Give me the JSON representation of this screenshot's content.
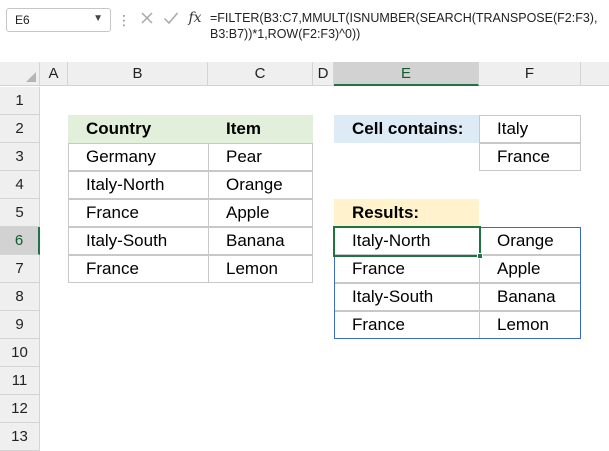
{
  "name_box": "E6",
  "formula": "=FILTER(B3:C7,MMULT(ISNUMBER(SEARCH(TRANSPOSE(F2:F3),\nB3:B7))*1,ROW(F2:F3)^0))",
  "columns": [
    "A",
    "B",
    "C",
    "D",
    "E",
    "F"
  ],
  "rows": [
    "1",
    "2",
    "3",
    "4",
    "5",
    "6",
    "7",
    "8",
    "9",
    "10",
    "11",
    "12",
    "13"
  ],
  "source_table": {
    "header_country": "Country",
    "header_item": "Item",
    "rows": [
      {
        "country": "Germany",
        "item": "Pear"
      },
      {
        "country": "Italy-North",
        "item": "Orange"
      },
      {
        "country": "France",
        "item": "Apple"
      },
      {
        "country": "Italy-South",
        "item": "Banana"
      },
      {
        "country": "France",
        "item": "Lemon"
      }
    ]
  },
  "criteria": {
    "label": "Cell contains:",
    "values": [
      "Italy",
      "France"
    ]
  },
  "results": {
    "label": "Results:",
    "rows": [
      {
        "country": "Italy-North",
        "item": "Orange"
      },
      {
        "country": "France",
        "item": "Apple"
      },
      {
        "country": "Italy-South",
        "item": "Banana"
      },
      {
        "country": "France",
        "item": "Lemon"
      }
    ]
  },
  "colors": {
    "header_green": "#e2efda",
    "header_blue": "#ddebf7",
    "header_yellow": "#fff2cc",
    "selection_green": "#217346",
    "spill_blue": "#3b6bc4"
  }
}
